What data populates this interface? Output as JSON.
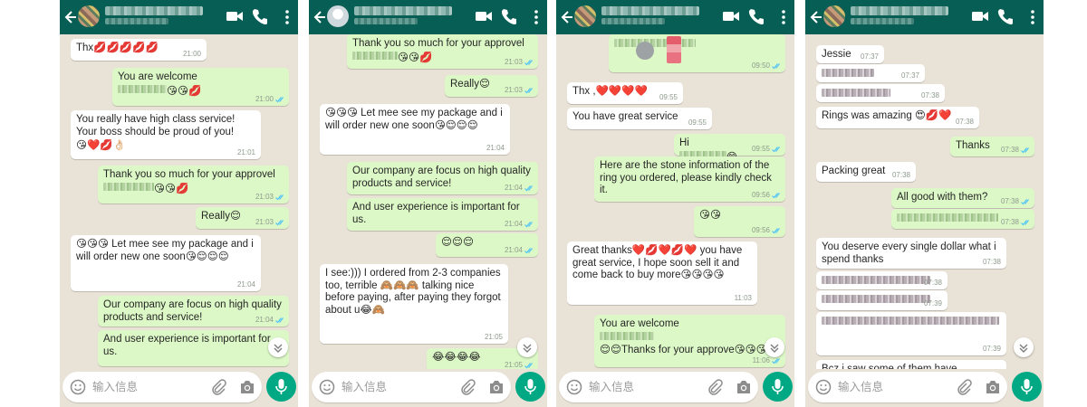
{
  "common": {
    "input_placeholder": "输入信息",
    "colors": {
      "header": "#075e54",
      "chat_bg": "#e9e2d6",
      "outgoing": "#dcf8c6",
      "incoming": "#ffffff",
      "mic_button": "#00a884",
      "read_ticks": "#4fc3f7"
    }
  },
  "screens": [
    {
      "messages": [
        {
          "dir": "in",
          "text": "Thx💋💋💋💋💋",
          "time": "21:00"
        },
        {
          "dir": "out",
          "text": "You are welcome",
          "tail_emoji": "😘😘💋",
          "time": "21:00"
        },
        {
          "dir": "in",
          "text": "You really have high class service! Your boss should be proud of you!",
          "tail_emoji": "😘❤️💋👌🏻",
          "time": "21:01"
        },
        {
          "dir": "out",
          "text": "Thank you so much for your approvel",
          "tail_emoji": "😘😘💋",
          "time": "21:03"
        },
        {
          "dir": "out",
          "text": "Really😌",
          "time": "21:03"
        },
        {
          "dir": "in",
          "text": "😘😘😘 Let mee see my package and i will order new one soon😘😌😌😌",
          "time": "21:04"
        },
        {
          "dir": "out",
          "text": "Our company are focus on high quality products and service!",
          "time": "21:04"
        },
        {
          "dir": "out",
          "text": "And user experience is important for us.",
          "time": ""
        }
      ]
    },
    {
      "messages": [
        {
          "dir": "out",
          "text": "Thank you so much for your approvel",
          "tail_emoji": "😘😘💋",
          "time": "21:03"
        },
        {
          "dir": "out",
          "text": "Really😌",
          "time": "21:03"
        },
        {
          "dir": "in",
          "text": "😘😘😘 Let mee see my package and i will order new one soon😘😌😌😌",
          "time": "21:04"
        },
        {
          "dir": "out",
          "text": "Our company are focus on high quality products and service!",
          "time": "21:04"
        },
        {
          "dir": "out",
          "text": "And user experience is important for us.",
          "time": "21:04"
        },
        {
          "dir": "out",
          "text": "😌😌😌",
          "time": "21:04"
        },
        {
          "dir": "in",
          "text": "I see:))) I ordered from 2-3 companies too, terrible 🙈🙈🙈 talking nice before paying, after paying they forgot about u😂🙈",
          "time": "21:05"
        },
        {
          "dir": "out",
          "text": "😂😂😂😂",
          "time": "21:05"
        }
      ]
    },
    {
      "messages": [
        {
          "dir": "out",
          "text": "",
          "time": "09:50"
        },
        {
          "dir": "in",
          "text": "Thx ,❤️❤️❤️❤️",
          "time": "09:55"
        },
        {
          "dir": "in",
          "text": "You have great service",
          "time": "09:55"
        },
        {
          "dir": "out",
          "text": "Hi",
          "tail_emoji": "😁",
          "time": "09:55"
        },
        {
          "dir": "out",
          "text": "Here are the stone information of the ring you ordered, please kindly check it.",
          "time": "09:56"
        },
        {
          "dir": "out",
          "text": "😘😘",
          "time": "09:56"
        },
        {
          "dir": "in",
          "text": "Great thanks❤️💋❤️💋❤️ you have great service, I hope soon sell it and come back to buy more😘😘😘😘",
          "time": "11:03"
        },
        {
          "dir": "out",
          "text": "You are welcome",
          "tail_emoji": "😌😌Thanks for your approve😘😘😘💋",
          "time": "11:06"
        }
      ]
    },
    {
      "messages": [
        {
          "dir": "in",
          "text": "Jessie",
          "time": "07:37"
        },
        {
          "dir": "in",
          "text": "",
          "time": "07:37"
        },
        {
          "dir": "in",
          "text": "",
          "time": "07:38"
        },
        {
          "dir": "in",
          "text": "Rings was amazing 😍💋❤️",
          "time": "07:38"
        },
        {
          "dir": "out",
          "text": "Thanks",
          "time": "07:38"
        },
        {
          "dir": "in",
          "text": "Packing great",
          "time": "07:38"
        },
        {
          "dir": "out",
          "text": "All good with them?",
          "time": "07:38"
        },
        {
          "dir": "out",
          "text": "",
          "time": "07:38"
        },
        {
          "dir": "in",
          "text": "You deserve every single dollar what i spend thanks",
          "time": "07:38"
        },
        {
          "dir": "in",
          "text": "",
          "time": "07:38"
        },
        {
          "dir": "in",
          "text": "",
          "time": "07:39"
        },
        {
          "dir": "in",
          "text": "",
          "time": "07:39"
        },
        {
          "dir": "in",
          "text": "Bcz i saw some of them have",
          "time": ""
        }
      ]
    }
  ]
}
